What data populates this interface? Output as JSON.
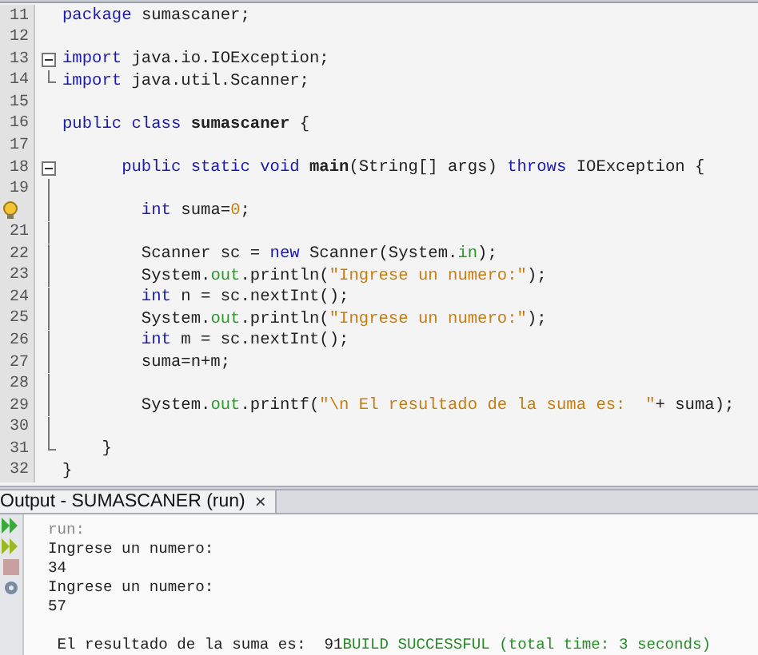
{
  "editor": {
    "lines": [
      {
        "number": "11",
        "segments": [
          {
            "kind": "kw",
            "text": "package"
          },
          {
            "kind": "plain",
            "text": " sumascaner;"
          }
        ]
      },
      {
        "number": "12"
      },
      {
        "number": "13",
        "expanded": true,
        "segments": [
          {
            "kind": "kw",
            "text": "import"
          },
          {
            "kind": "plain",
            "text": " java.io.IOException;"
          }
        ]
      },
      {
        "number": "14",
        "fold_end": true,
        "segments": [
          {
            "kind": "kw",
            "text": "import"
          },
          {
            "kind": "plain",
            "text": " java.util.Scanner;"
          }
        ]
      },
      {
        "number": "15"
      },
      {
        "number": "16",
        "segments": [
          {
            "kind": "kw",
            "text": "public class "
          },
          {
            "kind": "bold",
            "text": "sumascaner"
          },
          {
            "kind": "plain",
            "text": " {"
          }
        ]
      },
      {
        "number": "17"
      },
      {
        "number": "18",
        "expanded": true,
        "segments": [
          {
            "kind": "kw",
            "text": "      public static void "
          },
          {
            "kind": "bold",
            "text": "main"
          },
          {
            "kind": "plain",
            "text": "(String[] args) "
          },
          {
            "kind": "kw",
            "text": "throws"
          },
          {
            "kind": "plain",
            "text": " IOException {"
          }
        ]
      },
      {
        "number": "19"
      },
      {
        "hint": true,
        "segments": [
          {
            "kind": "kw",
            "text": "        int"
          },
          {
            "kind": "plain",
            "text": " suma="
          },
          {
            "kind": "num",
            "text": "0"
          },
          {
            "kind": "plain",
            "text": ";"
          }
        ]
      },
      {
        "number": "21"
      },
      {
        "number": "22",
        "segments": [
          {
            "kind": "plain",
            "text": "        Scanner sc = "
          },
          {
            "kind": "kw",
            "text": "new"
          },
          {
            "kind": "plain",
            "text": " Scanner(System."
          },
          {
            "kind": "field",
            "text": "in"
          },
          {
            "kind": "plain",
            "text": ");"
          }
        ]
      },
      {
        "number": "23",
        "segments": [
          {
            "kind": "plain",
            "text": "        System."
          },
          {
            "kind": "field",
            "text": "out"
          },
          {
            "kind": "plain",
            "text": ".println("
          },
          {
            "kind": "str",
            "text": "\"Ingrese un numero:\""
          },
          {
            "kind": "plain",
            "text": ");"
          }
        ]
      },
      {
        "number": "24",
        "segments": [
          {
            "kind": "kw",
            "text": "        int"
          },
          {
            "kind": "plain",
            "text": " n = sc.nextInt();"
          }
        ]
      },
      {
        "number": "25",
        "segments": [
          {
            "kind": "plain",
            "text": "        System."
          },
          {
            "kind": "field",
            "text": "out"
          },
          {
            "kind": "plain",
            "text": ".println("
          },
          {
            "kind": "str",
            "text": "\"Ingrese un numero:\""
          },
          {
            "kind": "plain",
            "text": ");"
          }
        ]
      },
      {
        "number": "26",
        "segments": [
          {
            "kind": "kw",
            "text": "        int"
          },
          {
            "kind": "plain",
            "text": " m = sc.nextInt();"
          }
        ]
      },
      {
        "number": "27",
        "segments": [
          {
            "kind": "plain",
            "text": "        suma=n+m;"
          }
        ]
      },
      {
        "number": "28"
      },
      {
        "number": "29",
        "segments": [
          {
            "kind": "plain",
            "text": "        System."
          },
          {
            "kind": "field",
            "text": "out"
          },
          {
            "kind": "plain",
            "text": ".printf("
          },
          {
            "kind": "str",
            "text": "\"\\n El resultado de la suma es:  \""
          },
          {
            "kind": "plain",
            "text": "+ suma);"
          }
        ]
      },
      {
        "number": "30"
      },
      {
        "number": "31",
        "fold_end": true,
        "segments": [
          {
            "kind": "plain",
            "text": "    }"
          }
        ]
      },
      {
        "number": "32",
        "segments": [
          {
            "kind": "plain",
            "text": "}"
          }
        ]
      }
    ]
  },
  "output": {
    "tab": {
      "title": "Output - SUMASCANER (run)",
      "close": "×"
    },
    "lines": [
      {
        "segments": [
          {
            "kind": "muted",
            "text": "run:"
          }
        ]
      },
      {
        "segments": [
          {
            "kind": "plain",
            "text": "Ingrese un numero:"
          }
        ]
      },
      {
        "segments": [
          {
            "kind": "plain",
            "text": "34"
          }
        ]
      },
      {
        "segments": [
          {
            "kind": "plain",
            "text": "Ingrese un numero:"
          }
        ]
      },
      {
        "segments": [
          {
            "kind": "plain",
            "text": "57"
          }
        ]
      },
      {
        "gap_before": true,
        "segments": [
          {
            "kind": "plain",
            "text": " El resultado de la suma es:  91"
          },
          {
            "kind": "success",
            "text": "BUILD SUCCESSFUL (total time: 3 seconds)"
          }
        ]
      }
    ]
  }
}
